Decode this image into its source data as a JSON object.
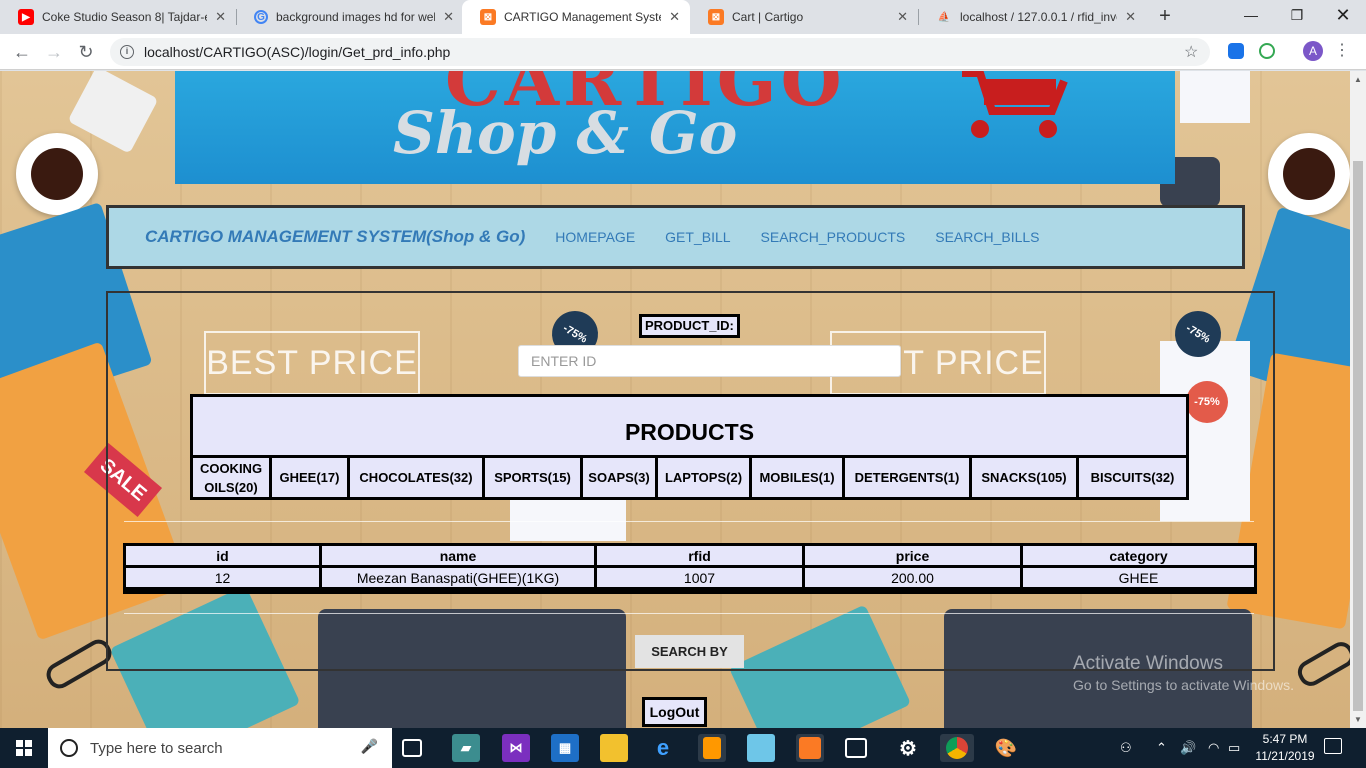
{
  "browser": {
    "tabs": [
      {
        "title": "Coke Studio Season 8| Tajdar-e",
        "favicon": "youtube-icon",
        "color": "#ff0000"
      },
      {
        "title": "background images hd for wel",
        "favicon": "google-icon",
        "color": "#4285f4"
      },
      {
        "title": "CARTIGO Management System",
        "favicon": "xampp-icon",
        "color": "#fb7a24",
        "active": true
      },
      {
        "title": "Cart | Cartigo",
        "favicon": "xampp-icon",
        "color": "#fb7a24"
      },
      {
        "title": "localhost / 127.0.0.1 / rfid_inve",
        "favicon": "phpmyadmin-icon",
        "color": "#f29111"
      }
    ],
    "new_tab": "+",
    "url": "localhost/CARTIGO(ASC)/login/Get_prd_info.php",
    "profile_initial": "A"
  },
  "banner": {
    "logo_top": "CARTIGO",
    "logo_sub": "Shop & Go"
  },
  "nav": {
    "brand": "CARTIGO MANAGEMENT SYSTEM(Shop & Go)",
    "links": [
      "HOMEPAGE",
      "GET_BILL",
      "SEARCH_PRODUCTS",
      "SEARCH_BILLS"
    ]
  },
  "form": {
    "product_id_label": "PRODUCT_ID:",
    "product_id_placeholder": "ENTER ID",
    "product_id_value": ""
  },
  "products": {
    "heading": "PRODUCTS",
    "categories": [
      "COOKING OILS(20)",
      "GHEE(17)",
      "CHOCOLATES(32)",
      "SPORTS(15)",
      "SOAPS(3)",
      "LAPTOPS(2)",
      "MOBILES(1)",
      "DETERGENTS(1)",
      "SNACKS(105)",
      "BISCUITS(32)"
    ]
  },
  "results": {
    "columns": [
      "id",
      "name",
      "rfid",
      "price",
      "category"
    ],
    "rows": [
      [
        "12",
        "Meezan Banaspati(GHEE)(1KG)",
        "1007",
        "200.00",
        "GHEE"
      ]
    ]
  },
  "actions": {
    "search_by": "SEARCH BY",
    "logout": "LogOut"
  },
  "background_text": {
    "price_left": "BEST PRICE",
    "price_right": "BEST PRICE",
    "tag_discount": "-75%",
    "sale": "SALE"
  },
  "watermark": {
    "line1": "Activate Windows",
    "line2": "Go to Settings to activate Windows."
  },
  "taskbar": {
    "search_placeholder": "Type here to search",
    "time": "5:47 PM",
    "date": "11/21/2019"
  },
  "colors": {
    "nav_bg": "#add8e6",
    "link": "#337ab7",
    "cell_bg": "#e6e6fa",
    "banner": "#2aa7de"
  }
}
